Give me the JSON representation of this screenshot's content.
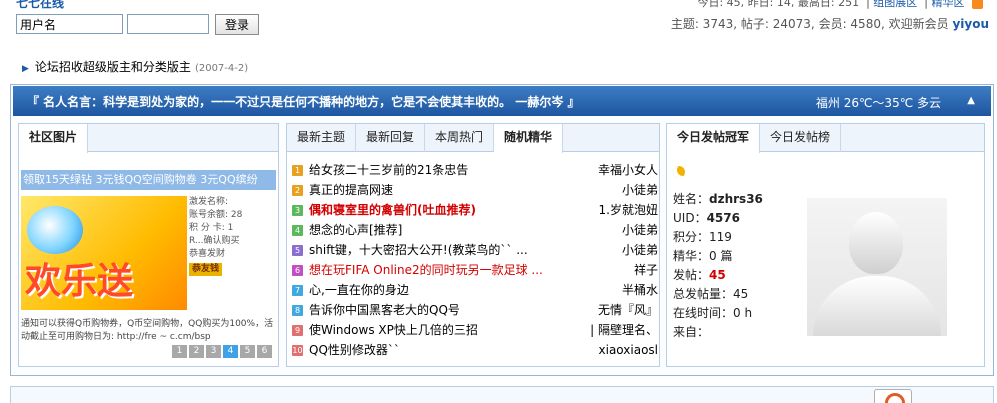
{
  "site": {
    "name": "七七在线"
  },
  "login": {
    "username_value": "用户名",
    "password_value": "",
    "button": "登录"
  },
  "stats_top": {
    "today": "今日: 45,",
    "yesterday": "昨日: 14,",
    "max": "最高日: 251",
    "link1": "组图展区",
    "link2": "精华区"
  },
  "stats_bottom": {
    "topics": "主题: 3743,",
    "posts": "帖子: 24073,",
    "members": "会员: 4580,",
    "welcome": "欢迎新会员",
    "new_member": "yiyou"
  },
  "announcement": {
    "title": "论坛招收超级版主和分类版主",
    "date": "(2007-4-2)"
  },
  "quote_bar": {
    "text": "『 名人名言：科学是到处为家的，一一不过只是任何不播种的地方，它是不会使其丰收的。 一赫尔岑 』",
    "weather": "福州  26℃～35℃ 多云",
    "collapse": "▲"
  },
  "left_panel": {
    "tab": "社区图片",
    "marquee": "领取15天绿钻 3元钱QQ空间购物卷 3元QQ缤纷",
    "promo_text": "欢乐送",
    "promo_side": [
      "激发名称:",
      "账号余额: 28",
      "积 分 卡: 1",
      "R...确认购买",
      "恭喜发财"
    ],
    "promo_chip": "恭友钱",
    "caption": "通知可以获得Q币购物券，Q币空间购物，QQ购买为100%，活动截止至可用购物日为: http://fre ~ c.cm/bsp",
    "pages": [
      "1",
      "2",
      "3",
      "4",
      "5",
      "6"
    ],
    "active_page": "4"
  },
  "middle_panel": {
    "tabs": [
      "最新主题",
      "最新回复",
      "本周热门",
      "随机精华"
    ],
    "active_tab": "随机精华",
    "topics": [
      {
        "num": "1",
        "title": "给女孩二十三岁前的21条忠告",
        "author": "幸福小女人",
        "color": "#e8a020",
        "red": false,
        "bold": false
      },
      {
        "num": "2",
        "title": "真正的提高网速",
        "author": "小徒弟",
        "color": "#e8a020",
        "red": false,
        "bold": false
      },
      {
        "num": "3",
        "title": "偶和寝室里的禽兽们(吐血推荐)",
        "author": "1.岁就泡妞",
        "color": "#5cb85c",
        "red": true,
        "bold": true
      },
      {
        "num": "4",
        "title": "想念的心声[推荐]",
        "author": "小徒弟",
        "color": "#5cb85c",
        "red": false,
        "bold": false
      },
      {
        "num": "5",
        "title": "shift键，十大密招大公开!(教菜鸟的`` ...",
        "author": "小徒弟",
        "color": "#8a6ed0",
        "red": false,
        "bold": false
      },
      {
        "num": "6",
        "title": "想在玩FIFA Online2的同时玩另一款足球 ...",
        "author": "祥子",
        "color": "#c050c0",
        "red": true,
        "bold": false
      },
      {
        "num": "7",
        "title": "心,一直在你的身边",
        "author": "半桶水",
        "color": "#40a8e0",
        "red": false,
        "bold": false
      },
      {
        "num": "8",
        "title": "告诉你中国黑客老大的QQ号",
        "author": "无情『风』",
        "color": "#40a8e0",
        "red": false,
        "bold": false
      },
      {
        "num": "9",
        "title": "使Windows XP快上几倍的三招",
        "author": "| 隔壁理名、",
        "color": "#e07070",
        "red": false,
        "bold": false
      },
      {
        "num": "10",
        "title": "QQ性别修改器``",
        "author": "xiaoxiaosl",
        "color": "#e07070",
        "red": false,
        "bold": false
      }
    ]
  },
  "right_panel": {
    "tabs": [
      "今日发帖冠军",
      "今日发帖榜"
    ],
    "active_tab": "今日发帖冠军",
    "info": {
      "name_label": "姓名：",
      "name": "dzhrs36",
      "uid_label": "UID：",
      "uid": "4576",
      "points": "积分：119",
      "digest": "精华：0 篇",
      "today_label": "发帖：",
      "today_posts": "45",
      "total": "总发帖量：45",
      "online": "在线时间：0 h",
      "from": "来自："
    }
  }
}
